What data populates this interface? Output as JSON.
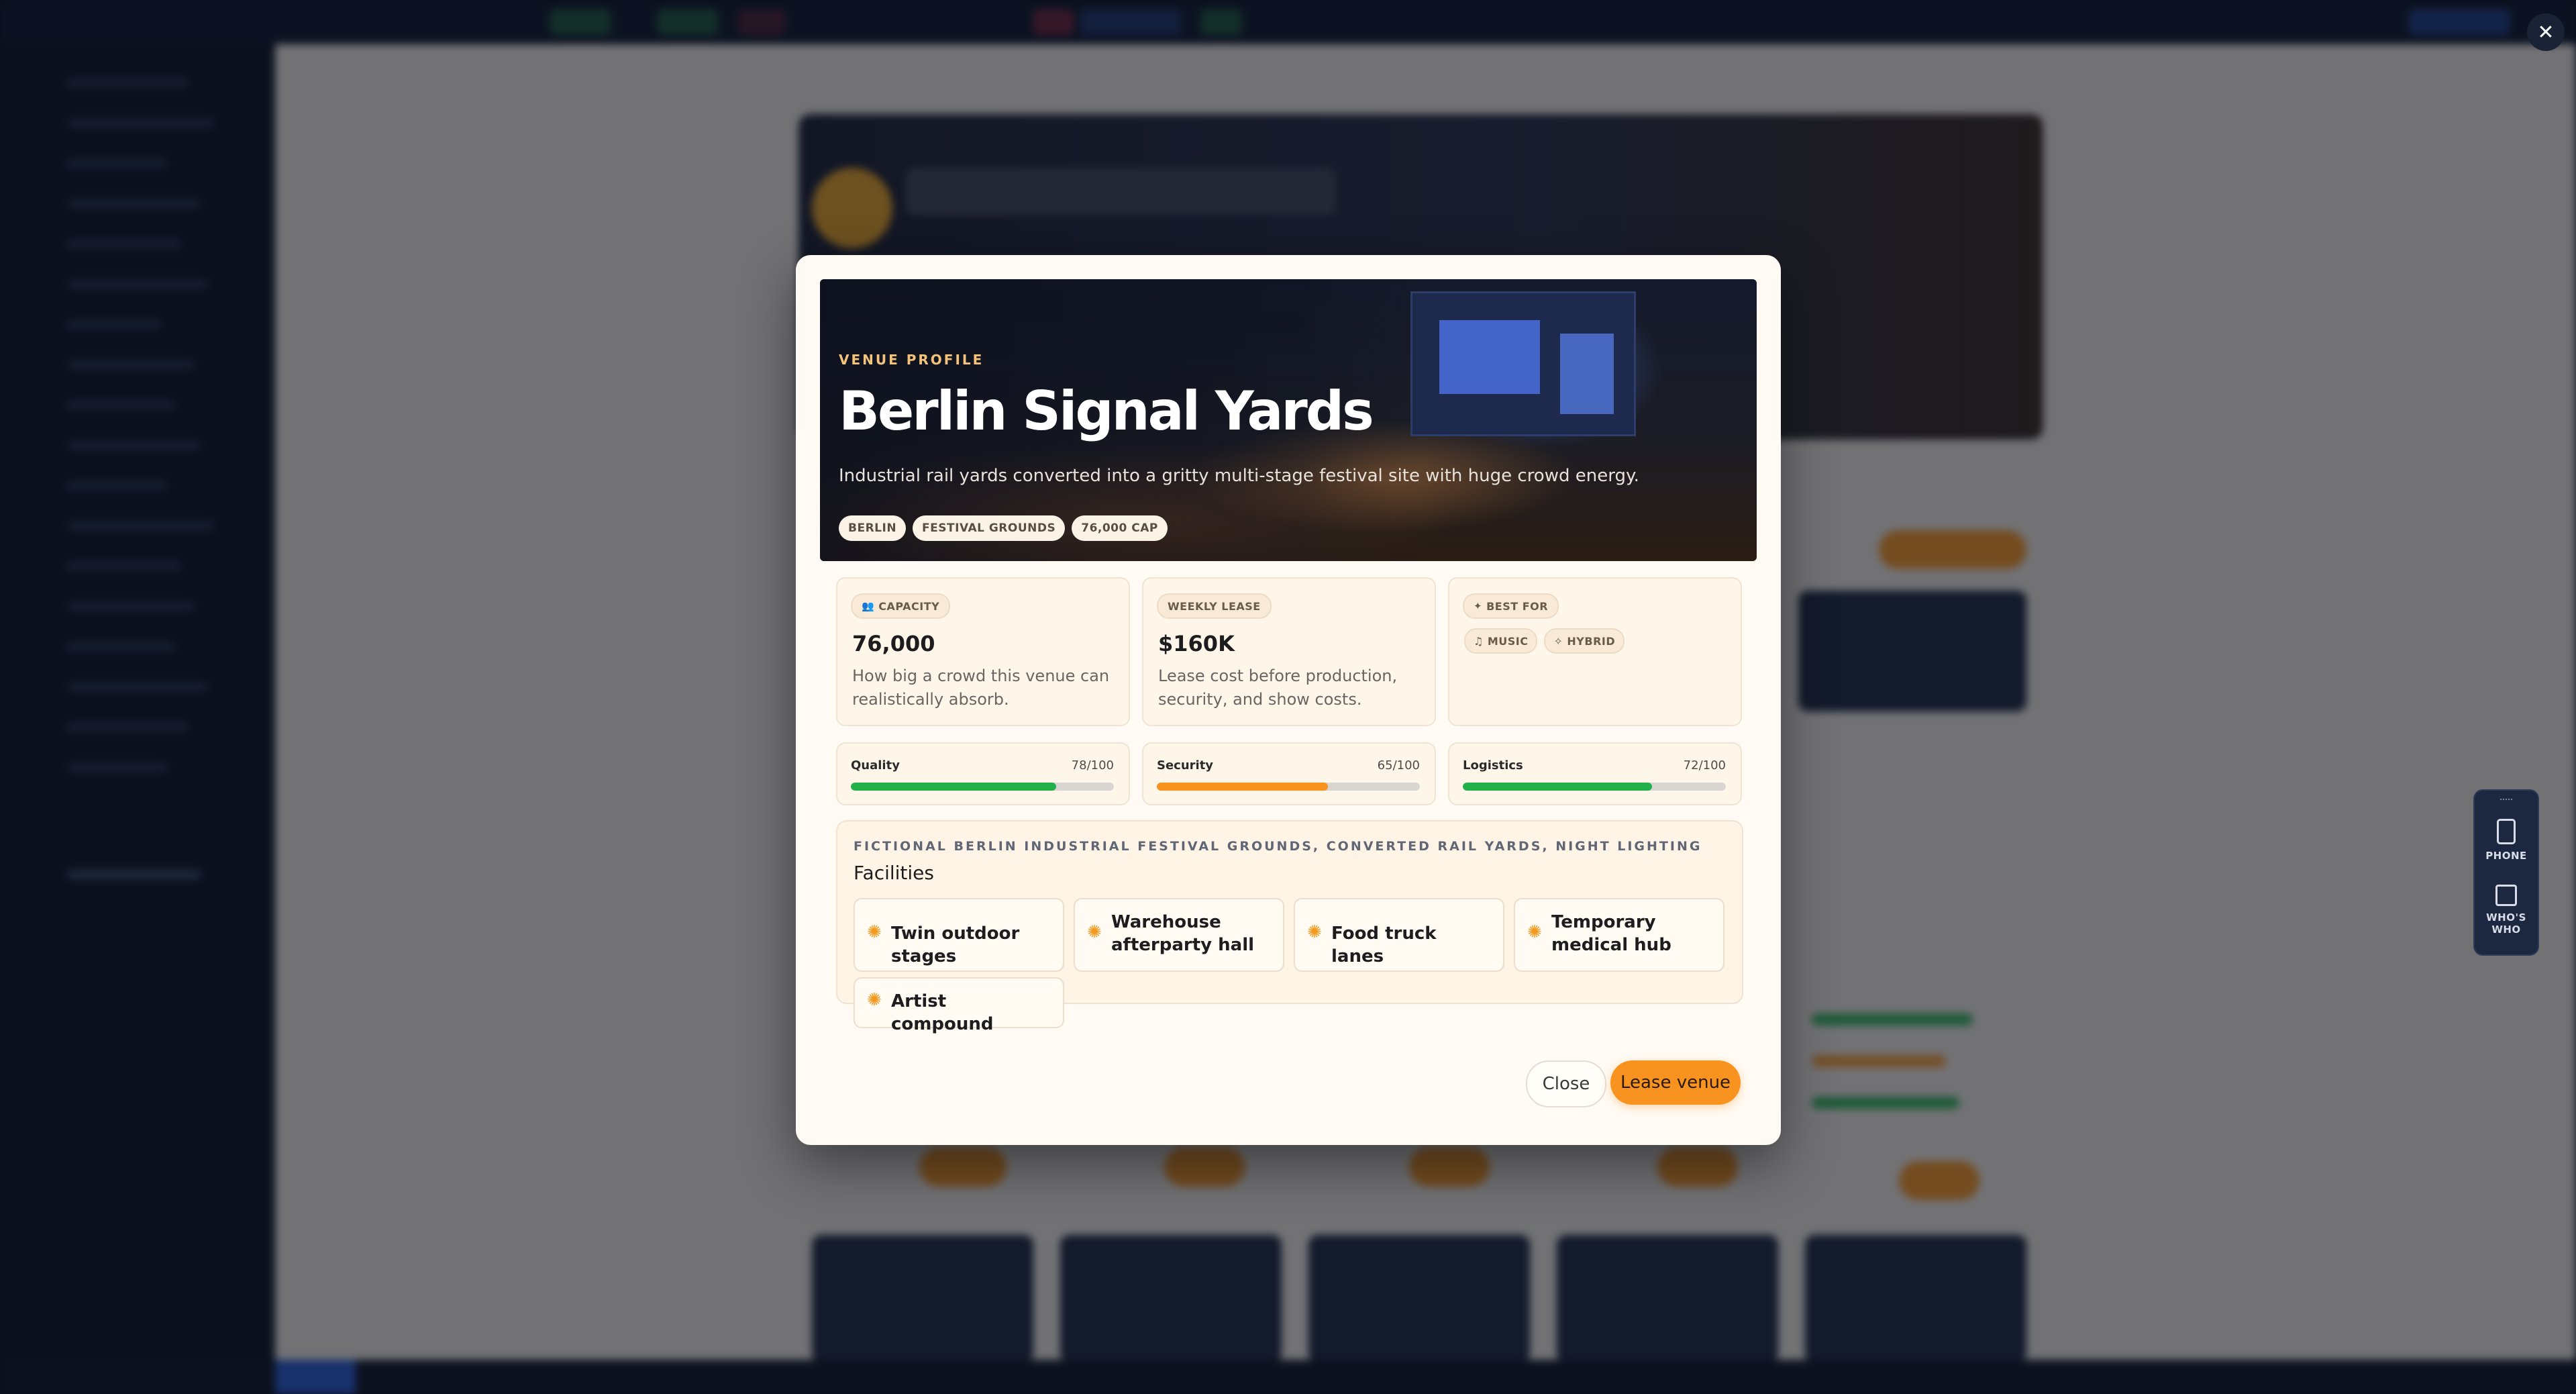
{
  "modal": {
    "eyebrow": "VENUE PROFILE",
    "title": "Berlin Signal Yards",
    "description": "Industrial rail yards converted into a gritty multi-stage festival site with huge crowd energy.",
    "tags": [
      "BERLIN",
      "FESTIVAL GROUNDS",
      "76,000 CAP"
    ],
    "stats": {
      "capacity": {
        "label": "CAPACITY",
        "value": "76,000",
        "note": "How big a crowd this venue can realistically absorb."
      },
      "lease": {
        "label": "WEEKLY LEASE",
        "value": "$160K",
        "note": "Lease cost before production, security, and show costs."
      },
      "best_for": {
        "label": "BEST FOR",
        "chips": [
          "MUSIC",
          "HYBRID"
        ]
      }
    },
    "meters": [
      {
        "name": "Quality",
        "score": "78/100",
        "value": 78,
        "color": "#22b04b"
      },
      {
        "name": "Security",
        "score": "65/100",
        "value": 65,
        "color": "#f7931e"
      },
      {
        "name": "Logistics",
        "score": "72/100",
        "value": 72,
        "color": "#22b04b"
      }
    ],
    "facilities": {
      "kicker": "FICTIONAL BERLIN INDUSTRIAL FESTIVAL GROUNDS, CONVERTED RAIL YARDS, NIGHT LIGHTING",
      "heading": "Facilities",
      "items": [
        "Twin outdoor stages",
        "Warehouse afterparty hall",
        "Food truck lanes",
        "Temporary medical hub",
        "Artist compound"
      ]
    },
    "buttons": {
      "close": "Close",
      "lease": "Lease venue"
    }
  },
  "dock": {
    "phone": "PHONE",
    "whos_who": "WHO'S WHO"
  },
  "icons": {
    "corner_close": "close-icon"
  },
  "colors": {
    "accent": "#f7931e",
    "good": "#22b04b"
  }
}
